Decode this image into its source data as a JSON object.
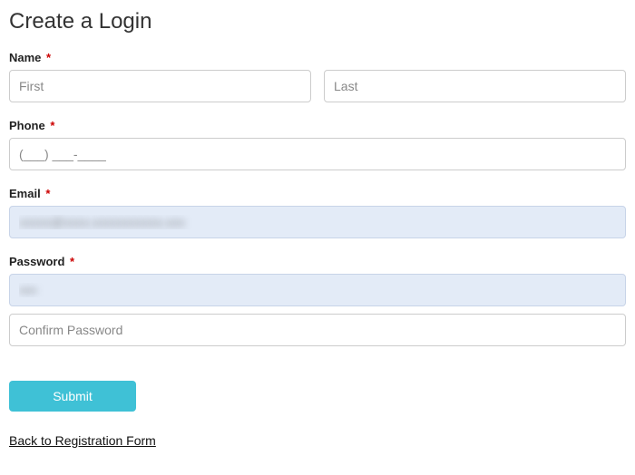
{
  "title": "Create a Login",
  "required_marker": "*",
  "name": {
    "label": "Name",
    "first_placeholder": "First",
    "last_placeholder": "Last",
    "first_value": "",
    "last_value": ""
  },
  "phone": {
    "label": "Phone",
    "placeholder": "(___) ___-____",
    "value": ""
  },
  "email": {
    "label": "Email",
    "value": "xxxxx@xxxx.xxxxxxxxxxx.xxx"
  },
  "password": {
    "label": "Password",
    "value": "xxxx",
    "confirm_placeholder": "Confirm Password",
    "confirm_value": ""
  },
  "submit_label": "Submit",
  "back_link_label": "Back to Registration Form"
}
